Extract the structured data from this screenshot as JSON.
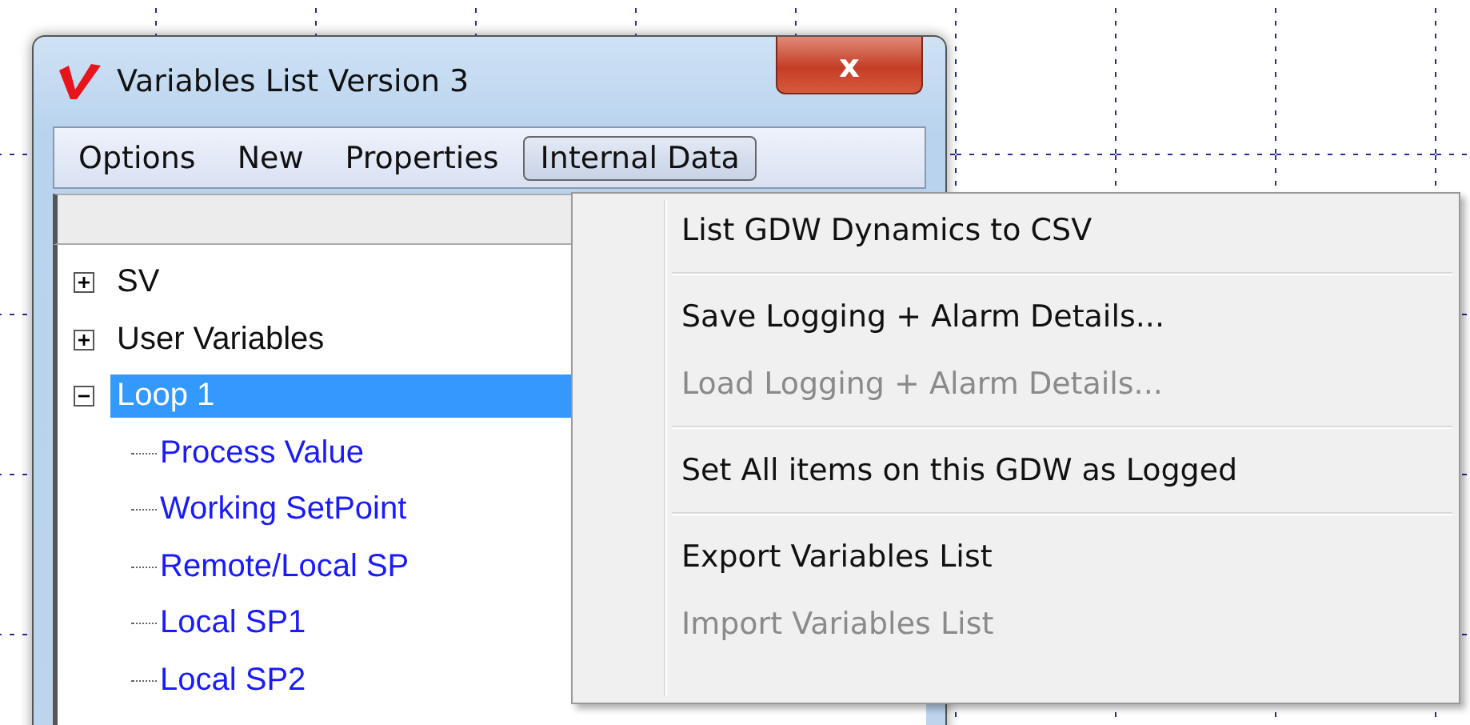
{
  "window": {
    "title": "Variables List Version 3",
    "close": "x"
  },
  "menu_bar": [
    {
      "label": "Options",
      "selected": false
    },
    {
      "label": "New",
      "selected": false
    },
    {
      "label": "Properties",
      "selected": false
    },
    {
      "label": "Internal Data",
      "selected": true
    }
  ],
  "tree": [
    {
      "label": "SV",
      "expanded": false,
      "selected": false
    },
    {
      "label": "User Variables",
      "expanded": false,
      "selected": false
    },
    {
      "label": "Loop 1",
      "expanded": true,
      "selected": true,
      "children": [
        {
          "label": "Process Value"
        },
        {
          "label": "Working SetPoint"
        },
        {
          "label": "Remote/Local SP"
        },
        {
          "label": "Local SP1"
        },
        {
          "label": "Local SP2"
        }
      ]
    }
  ],
  "dropdown_menu": [
    {
      "kind": "item",
      "label": "List GDW Dynamics to CSV",
      "disabled": false
    },
    {
      "kind": "separator"
    },
    {
      "kind": "item",
      "label": "Save Logging + Alarm Details...",
      "disabled": false
    },
    {
      "kind": "item",
      "label": "Load Logging + Alarm Details...",
      "disabled": true
    },
    {
      "kind": "separator"
    },
    {
      "kind": "item",
      "label": "Set All items on this GDW as Logged",
      "disabled": false
    },
    {
      "kind": "separator"
    },
    {
      "kind": "item",
      "label": "Export Variables List",
      "disabled": false
    },
    {
      "kind": "item",
      "label": "Import Variables List",
      "disabled": true
    }
  ]
}
